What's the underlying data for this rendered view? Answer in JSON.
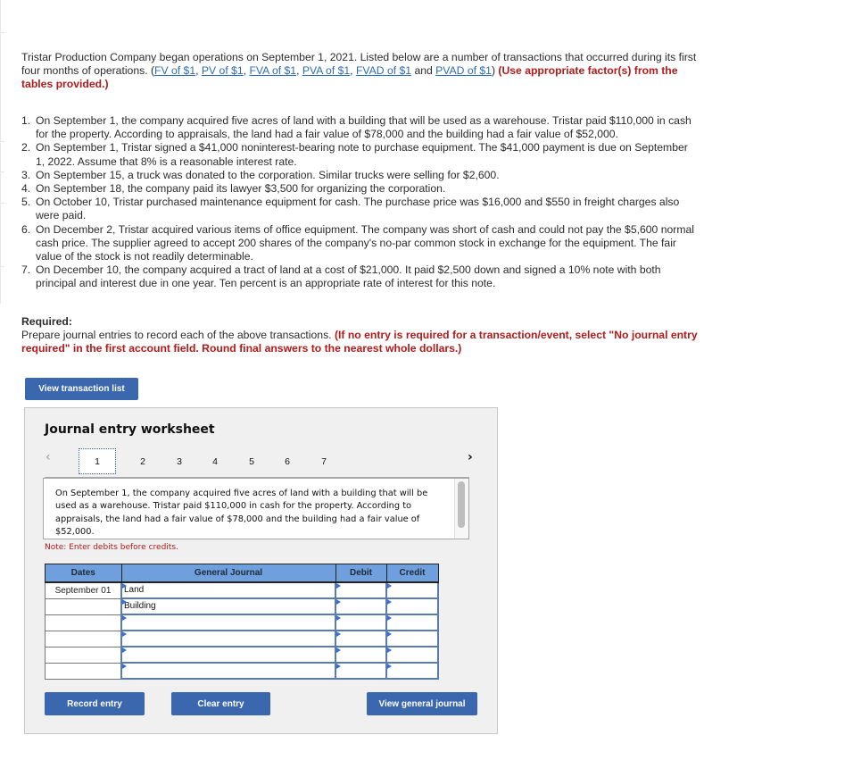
{
  "intro": {
    "text_before": "Tristar Production Company began operations on September 1, 2021. Listed below are a number of transactions that occurred during its first four months of operations. (",
    "links": [
      "FV of $1",
      "PV of $1",
      "FVA of $1",
      "PVA of $1",
      "FVAD of $1",
      "PVAD of $1"
    ],
    "and_word": "and",
    "instruction": "(Use appropriate factor(s) from the tables provided.)"
  },
  "transactions": [
    {
      "num": "1.",
      "text": "On September 1, the company acquired five acres of land with a building that will be used as a warehouse. Tristar paid $110,000 in cash for the property. According to appraisals, the land had a fair value of $78,000 and the building had a fair value of $52,000."
    },
    {
      "num": "2.",
      "text": "On September 1, Tristar signed a $41,000 noninterest-bearing note to purchase equipment. The $41,000 payment is due on September 1, 2022. Assume that 8% is a reasonable interest rate."
    },
    {
      "num": "3.",
      "text": "On September 15, a truck was donated to the corporation. Similar trucks were selling for $2,600."
    },
    {
      "num": "4.",
      "text": "On September 18, the company paid its lawyer $3,500 for organizing the corporation."
    },
    {
      "num": "5.",
      "text": "On October 10, Tristar purchased maintenance equipment for cash. The purchase price was $16,000 and $550 in freight charges also were paid."
    },
    {
      "num": "6.",
      "text": "On December 2, Tristar acquired various items of office equipment. The company was short of cash and could not pay the $5,600 normal cash price. The supplier agreed to accept 200 shares of the company's no-par common stock in exchange for the equipment. The fair value of the stock is not readily determinable."
    },
    {
      "num": "7.",
      "text": "On December 10, the company acquired a tract of land at a cost of $21,000. It paid $2,500 down and signed a 10% note with both principal and interest due in one year. Ten percent is an appropriate rate of interest for this note."
    }
  ],
  "required": {
    "title": "Required:",
    "text": "Prepare journal entries to record each of the above transactions. ",
    "instruction": "(If no entry is required for a transaction/event, select \"No journal entry required\" in the first account field. Round final answers to the nearest whole dollars.)"
  },
  "buttons": {
    "view_transaction_list": "View transaction list",
    "record_entry": "Record entry",
    "clear_entry": "Clear entry",
    "view_general_journal": "View general journal"
  },
  "worksheet": {
    "title": "Journal entry worksheet",
    "prev_icon": "chevron-left-icon",
    "next_icon": "chevron-right-icon",
    "tabs": [
      "1",
      "2",
      "3",
      "4",
      "5",
      "6",
      "7"
    ],
    "active_tab": "1",
    "description": "On September 1, the company acquired five acres of land with a building that will be used as a warehouse. Tristar paid $110,000 in cash for the property. According to appraisals, the land had a fair value of $78,000 and the building had a fair value of $52,000.",
    "note": "Note: Enter debits before credits.",
    "columns": [
      "Dates",
      "General Journal",
      "Debit",
      "Credit"
    ],
    "rows": [
      {
        "date": "September 01",
        "account": "Land",
        "debit": "",
        "credit": ""
      },
      {
        "date": "",
        "account": "Building",
        "debit": "",
        "credit": ""
      },
      {
        "date": "",
        "account": "",
        "debit": "",
        "credit": ""
      },
      {
        "date": "",
        "account": "",
        "debit": "",
        "credit": ""
      },
      {
        "date": "",
        "account": "",
        "debit": "",
        "credit": ""
      },
      {
        "date": "",
        "account": "",
        "debit": "",
        "credit": ""
      }
    ]
  },
  "colors": {
    "link": "#2d6db5",
    "instruction_red": "#b31b1b",
    "button_blue": "#3a67ae",
    "table_header": "#6f9fdc"
  }
}
